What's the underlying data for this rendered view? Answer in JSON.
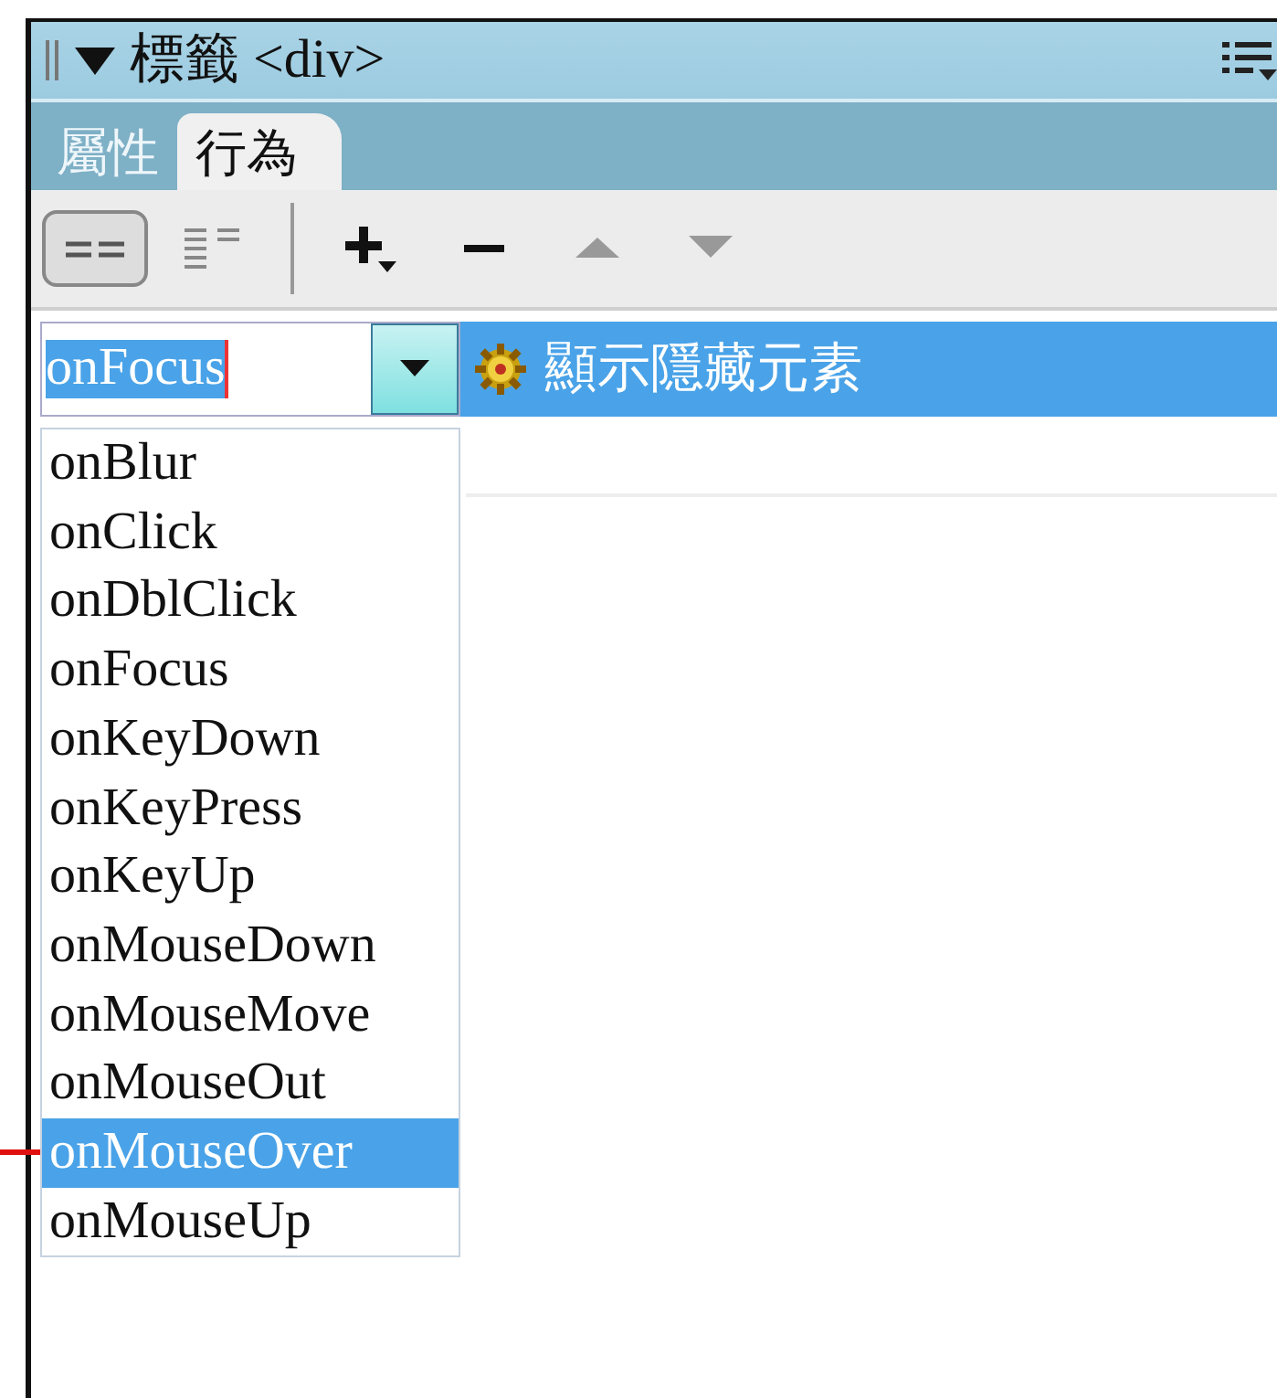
{
  "panel": {
    "title": "標籤 <div>",
    "expanded": true
  },
  "tabs": [
    {
      "label": "屬性",
      "selected": false
    },
    {
      "label": "行為",
      "selected": true
    }
  ],
  "view_modes": [
    {
      "kind": "set-events",
      "selected": true
    },
    {
      "kind": "all-events",
      "selected": false
    }
  ],
  "actions": [
    {
      "kind": "add",
      "disabled": false
    },
    {
      "kind": "remove",
      "disabled": false
    },
    {
      "kind": "up",
      "disabled": true
    },
    {
      "kind": "down",
      "disabled": true
    }
  ],
  "behaviors": [
    {
      "event": "onFocus",
      "action": "顯示隱藏元素",
      "selected": true
    }
  ],
  "event_dropdown": {
    "expanded": true,
    "options": [
      {
        "label": "onBlur",
        "selected": false
      },
      {
        "label": "onClick",
        "selected": false
      },
      {
        "label": "onDblClick",
        "selected": false
      },
      {
        "label": "onFocus",
        "selected": false
      },
      {
        "label": "onKeyDown",
        "selected": false
      },
      {
        "label": "onKeyPress",
        "selected": false
      },
      {
        "label": "onKeyUp",
        "selected": false
      },
      {
        "label": "onMouseDown",
        "selected": false
      },
      {
        "label": "onMouseMove",
        "selected": false
      },
      {
        "label": "onMouseOut",
        "selected": false
      },
      {
        "label": "onMouseOver",
        "selected": true
      },
      {
        "label": "onMouseUp",
        "selected": false
      }
    ]
  }
}
